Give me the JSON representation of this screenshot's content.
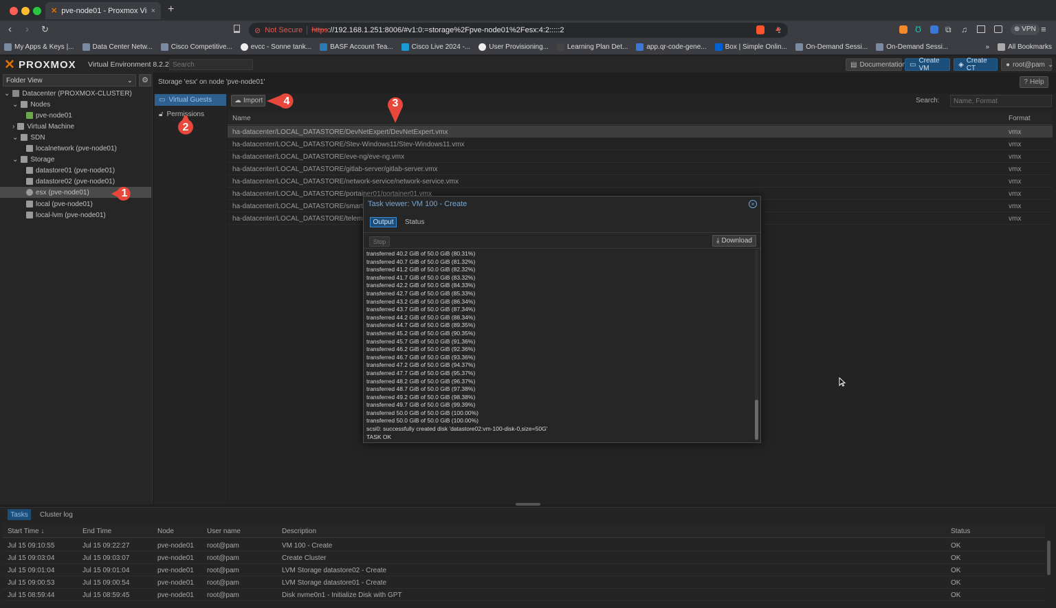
{
  "browser": {
    "tab_title": "pve-node01 - Proxmox Virtual",
    "not_secure": "Not Secure",
    "url_https": "https",
    "url_rest": "://192.168.1.251:8006/#v1:0:=storage%2Fpve-node01%2Fesx:4:2:::::2",
    "vpn": "VPN",
    "bookmarks": [
      "My Apps & Keys |...",
      "Data Center Netw...",
      "Cisco Competitive...",
      "evcc - Sonne tank...",
      "BASF Account Tea...",
      "Cisco Live 2024 -...",
      "User Provisioning...",
      "Learning Plan Det...",
      "app.qr-code-gene...",
      "Box | Simple Onlin...",
      "On-Demand Sessi...",
      "On-Demand Sessi..."
    ],
    "all_bookmarks": "All Bookmarks",
    "more": "»"
  },
  "pve": {
    "logo": "PROXMOX",
    "product": "Virtual Environment 8.2.2",
    "search_placeholder": "Search",
    "documentation": "Documentation",
    "create_vm": "Create VM",
    "create_ct": "Create CT",
    "user": "root@pam",
    "folder_view": "Folder View",
    "tree": [
      {
        "label": "Datacenter (PROXMOX-CLUSTER)"
      },
      {
        "label": "Nodes"
      },
      {
        "label": "pve-node01"
      },
      {
        "label": "Virtual Machine"
      },
      {
        "label": "SDN"
      },
      {
        "label": "localnetwork (pve-node01)"
      },
      {
        "label": "Storage"
      },
      {
        "label": "datastore01 (pve-node01)"
      },
      {
        "label": "datastore02 (pve-node01)"
      },
      {
        "label": "esx (pve-node01)"
      },
      {
        "label": "local (pve-node01)"
      },
      {
        "label": "local-lvm (pve-node01)"
      }
    ],
    "content_title": "Storage 'esx' on node 'pve-node01'",
    "help": "Help",
    "subnav": [
      "Virtual Guests",
      "Permissions"
    ],
    "import": "Import",
    "search_label": "Search:",
    "search_input_placeholder": "Name, Format",
    "col_name": "Name",
    "col_format": "Format",
    "guests": [
      {
        "name": "ha-datacenter/LOCAL_DATASTORE/DevNetExpert/DevNetExpert.vmx",
        "format": "vmx"
      },
      {
        "name": "ha-datacenter/LOCAL_DATASTORE/Stev-Windows11/Stev-Windows11.vmx",
        "format": "vmx"
      },
      {
        "name": "ha-datacenter/LOCAL_DATASTORE/eve-ng/eve-ng.vmx",
        "format": "vmx"
      },
      {
        "name": "ha-datacenter/LOCAL_DATASTORE/gitlab-server/gitlab-server.vmx",
        "format": "vmx"
      },
      {
        "name": "ha-datacenter/LOCAL_DATASTORE/network-service/network-service.vmx",
        "format": "vmx"
      },
      {
        "name": "ha-datacenter/LOCAL_DATASTORE/portainer01/portainer01.vmx",
        "format": "vmx"
      },
      {
        "name": "ha-datacenter/LOCAL_DATASTORE/smarthome",
        "format": "vmx"
      },
      {
        "name": "ha-datacenter/LOCAL_DATASTORE/telemetry",
        "format": "vmx"
      }
    ]
  },
  "modal": {
    "title": "Task viewer: VM 100 - Create",
    "tab_output": "Output",
    "tab_status": "Status",
    "stop": "Stop",
    "download": "Download",
    "log": [
      "transferred 40.2 GiB of 50.0 GiB (80.31%)",
      "transferred 40.7 GiB of 50.0 GiB (81.32%)",
      "transferred 41.2 GiB of 50.0 GiB (82.32%)",
      "transferred 41.7 GiB of 50.0 GiB (83.32%)",
      "transferred 42.2 GiB of 50.0 GiB (84.33%)",
      "transferred 42.7 GiB of 50.0 GiB (85.33%)",
      "transferred 43.2 GiB of 50.0 GiB (86.34%)",
      "transferred 43.7 GiB of 50.0 GiB (87.34%)",
      "transferred 44.2 GiB of 50.0 GiB (88.34%)",
      "transferred 44.7 GiB of 50.0 GiB (89.35%)",
      "transferred 45.2 GiB of 50.0 GiB (90.35%)",
      "transferred 45.7 GiB of 50.0 GiB (91.36%)",
      "transferred 46.2 GiB of 50.0 GiB (92.36%)",
      "transferred 46.7 GiB of 50.0 GiB (93.36%)",
      "transferred 47.2 GiB of 50.0 GiB (94.37%)",
      "transferred 47.7 GiB of 50.0 GiB (95.37%)",
      "transferred 48.2 GiB of 50.0 GiB (96.37%)",
      "transferred 48.7 GiB of 50.0 GiB (97.38%)",
      "transferred 49.2 GiB of 50.0 GiB (98.38%)",
      "transferred 49.7 GiB of 50.0 GiB (99.39%)",
      "transferred 50.0 GiB of 50.0 GiB (100.00%)",
      "transferred 50.0 GiB of 50.0 GiB (100.00%)",
      "scsi0: successfully created disk 'datastore02:vm-100-disk-0,size=50G'",
      "TASK OK"
    ]
  },
  "tasks": {
    "tab_tasks": "Tasks",
    "tab_cluster_log": "Cluster log",
    "headers": [
      "Start Time ↓",
      "End Time",
      "Node",
      "User name",
      "Description",
      "Status"
    ],
    "rows": [
      [
        "Jul 15 09:10:55",
        "Jul 15 09:22:27",
        "pve-node01",
        "root@pam",
        "VM 100 - Create",
        "OK"
      ],
      [
        "Jul 15 09:03:04",
        "Jul 15 09:03:07",
        "pve-node01",
        "root@pam",
        "Create Cluster",
        "OK"
      ],
      [
        "Jul 15 09:01:04",
        "Jul 15 09:01:04",
        "pve-node01",
        "root@pam",
        "LVM Storage datastore02 - Create",
        "OK"
      ],
      [
        "Jul 15 09:00:53",
        "Jul 15 09:00:54",
        "pve-node01",
        "root@pam",
        "LVM Storage datastore01 - Create",
        "OK"
      ],
      [
        "Jul 15 08:59:44",
        "Jul 15 08:59:45",
        "pve-node01",
        "root@pam",
        "Disk nvme0n1 - Initialize Disk with GPT",
        "OK"
      ]
    ]
  },
  "callouts": [
    "1",
    "2",
    "3",
    "4"
  ],
  "colors": {
    "accent": "#2d5f8f",
    "callout": "#e8473c",
    "logo_orange": "#e57000"
  }
}
